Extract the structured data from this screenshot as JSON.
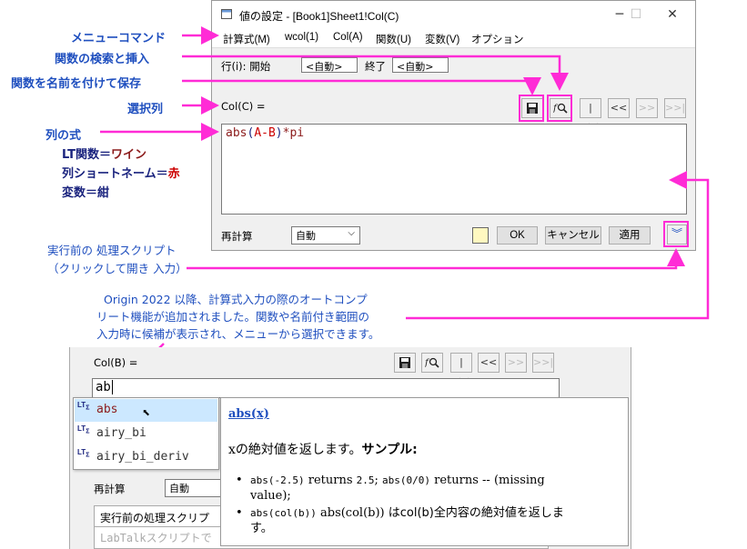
{
  "window": {
    "title": "値の設定 - [Book1]Sheet1!Col(C)",
    "minimize": "─",
    "maximize": "☐",
    "close": "✕"
  },
  "menu": [
    "計算式(M)",
    "wcol(1)",
    "Col(A)",
    "関数(U)",
    "変数(V)",
    "オプション"
  ],
  "row_range": {
    "label": "行(i): 開始",
    "start": "<自動>",
    "end_label": "終了",
    "end": "<自動>"
  },
  "col_label": "Col(C) =",
  "nav_buttons": [
    "|<<",
    "<<",
    ">>",
    ">>|"
  ],
  "formula": {
    "func": "abs",
    "open": "(",
    "var": "A-B",
    "close": ")",
    "rest": "*pi"
  },
  "bottom": {
    "recalc_label": "再計算",
    "recalc_value": "自動",
    "ok": "OK",
    "cancel": "キャンセル",
    "apply": "適用"
  },
  "annotations": {
    "menu_commands": "メニューコマンド",
    "search_insert": "関数の検索と挿入",
    "save_named": "関数を名前を付けて保存",
    "select_col": "選択列",
    "col_formula": "列の式",
    "legend1_prefix": "LT関数＝",
    "legend1_value": "ワイン",
    "legend2_prefix": "列ショートネーム＝",
    "legend2_value": "赤",
    "legend3": "変数＝紺",
    "pre_script_line1": "実行前の 処理スクリプト",
    "pre_script_line2": "（クリックして開き 入力）",
    "autocomplete_line1": "Origin 2022 以降、計算式入力の際のオートコンプ",
    "autocomplete_line2": "リート機能が追加されました。関数や名前付き範囲の",
    "autocomplete_line3": "入力時に候補が表示され、メニューから選択できます。"
  },
  "lower": {
    "col_label": "Col(B) =",
    "input_value": "ab",
    "suggestions": [
      "abs",
      "airy_bi",
      "airy_bi_deriv"
    ],
    "recalc_label": "再計算",
    "recalc_value": "自動",
    "script_tab": "実行前の処理スクリプト",
    "script_placeholder": "LabTalkスクリプトで"
  },
  "help": {
    "signature": "abs(x)",
    "desc_x": "x",
    "desc_main": "の絶対値を返します。",
    "desc_sample": "サンプル:",
    "b1_code1": "abs(-2.5)",
    "b1_t1": " returns ",
    "b1_code2": "2.5",
    "b1_t2": "; ",
    "b1_code3": "abs(0/0)",
    "b1_t3": " returns -- (missing",
    "b1_t4": "value);",
    "b2_code1": "abs(col(b))",
    "b2_t1": " abs(col(b)) ",
    "b2_t2": "はcol(b)全内容の絶対値を返しま",
    "b2_t3": "す。"
  },
  "colors": {
    "accent_pink": "#ff2bd6",
    "annotation_blue": "#1f4fbf",
    "lt_function_wine": "#8b1a1a",
    "short_name_red": "#cc0000",
    "variable_navy": "#1a237e"
  }
}
